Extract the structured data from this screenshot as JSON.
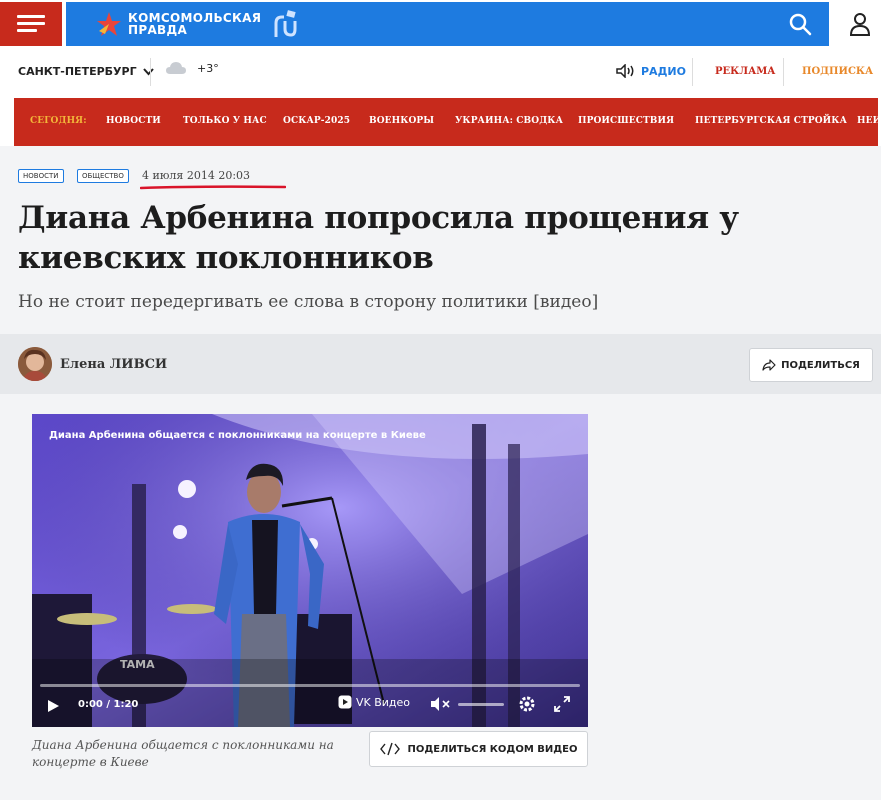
{
  "header": {
    "logo_text": "КОМСОМОЛЬСКАЯ ПРАВДА",
    "logo_suffix": "RU",
    "brand_red": "#c72a1c",
    "brand_blue": "#1e7be0",
    "icons": [
      "menu-icon",
      "search-icon",
      "user-icon"
    ]
  },
  "subheader": {
    "city": "САНКТ-ПЕТЕРБУРГ",
    "temperature": "+3°",
    "radio": "РАДИО",
    "ads": "РЕКЛАМА",
    "subscribe": "ПОДПИСКА"
  },
  "nav": {
    "today_label": "СЕГОДНЯ:",
    "items": [
      "НОВОСТИ",
      "ТОЛЬКО У НАС",
      "ОСКАР-2025",
      "ВОЕНКОРЫ",
      "УКРАИНА: СВОДКА",
      "ПРОИСШЕСТВИЯ",
      "ПЕТЕРБУРГСКАЯ СТРОЙКА",
      "НЕИ"
    ]
  },
  "article": {
    "tags": [
      "НОВОСТИ",
      "ОБЩЕСТВО"
    ],
    "date": "4 июля 2014 20:03",
    "title": "Диана Арбенина попросила прощения у киевских поклонников",
    "subtitle": "Но не стоит передергивать ее слова в сторону политики [видео]",
    "author": "Елена ЛИВСИ",
    "share_label": "ПОДЕЛИТЬСЯ"
  },
  "video": {
    "title": "Диана Арбенина общается с поклонниками на концерте в Киеве",
    "time": "0:00 / 1:20",
    "brand": "VK Видео",
    "drum_brand": "TAMA",
    "caption": "Диана Арбенина общается с поклонниками на концерте в Киеве",
    "embed_label": "ПОДЕЛИТЬСЯ КОДОМ ВИДЕО",
    "progress": 0
  }
}
